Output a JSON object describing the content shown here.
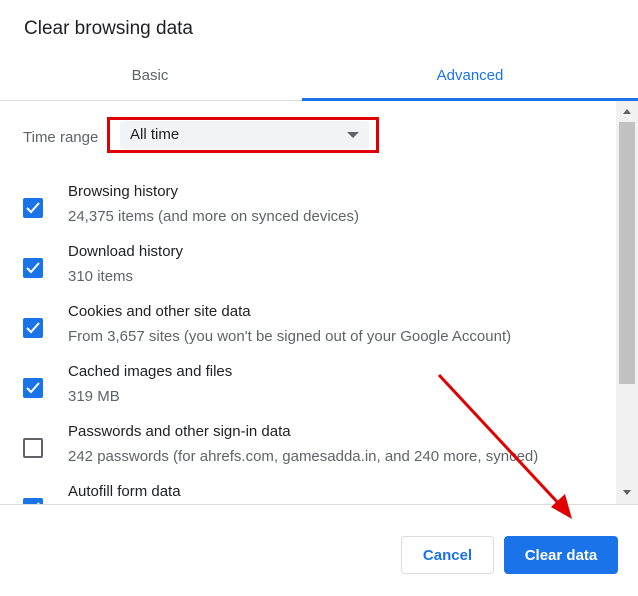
{
  "dialog": {
    "title": "Clear browsing data"
  },
  "tabs": [
    {
      "label": "Basic",
      "active": false
    },
    {
      "label": "Advanced",
      "active": true
    }
  ],
  "time_range": {
    "label": "Time range",
    "value": "All time"
  },
  "items": [
    {
      "title": "Browsing history",
      "subtitle": "24,375 items (and more on synced devices)",
      "checked": true
    },
    {
      "title": "Download history",
      "subtitle": "310 items",
      "checked": true
    },
    {
      "title": "Cookies and other site data",
      "subtitle": "From 3,657 sites (you won't be signed out of your Google Account)",
      "checked": true
    },
    {
      "title": "Cached images and files",
      "subtitle": "319 MB",
      "checked": true
    },
    {
      "title": "Passwords and other sign-in data",
      "subtitle": "242 passwords (for ahrefs.com, gamesadda.in, and 240 more, synced)",
      "checked": false
    },
    {
      "title": "Autofill form data",
      "subtitle": "",
      "checked": true
    }
  ],
  "footer": {
    "cancel_label": "Cancel",
    "clear_label": "Clear data"
  },
  "colors": {
    "accent": "#1a73e8",
    "annotation": "#e00000"
  }
}
